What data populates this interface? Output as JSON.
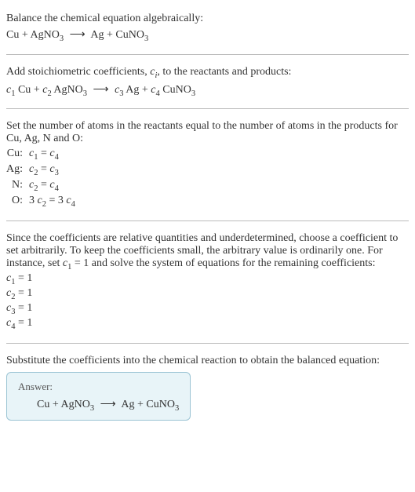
{
  "step1": {
    "title": "Balance the chemical equation algebraically:",
    "eq_lhs1": "Cu",
    "eq_plus": " + ",
    "eq_lhs2": "AgNO",
    "eq_lhs2_sub": "3",
    "eq_arrow": "⟶",
    "eq_rhs1": "Ag",
    "eq_rhs2": "CuNO",
    "eq_rhs2_sub": "3"
  },
  "step2": {
    "title_a": "Add stoichiometric coefficients, ",
    "title_ci": "c",
    "title_ci_sub": "i",
    "title_b": ", to the reactants and products:",
    "c1": "c",
    "c1s": "1",
    "t1": " Cu",
    "c2": "c",
    "c2s": "2",
    "t2": " AgNO",
    "t2s": "3",
    "c3": "c",
    "c3s": "3",
    "t3": " Ag",
    "c4": "c",
    "c4s": "4",
    "t4": " CuNO",
    "t4s": "3",
    "plus": " + ",
    "arrow": "⟶"
  },
  "step3": {
    "title": "Set the number of atoms in the reactants equal to the number of atoms in the products for Cu, Ag, N and O:",
    "rows": [
      {
        "el": "Cu:",
        "lhs_c": "c",
        "lhs_s": "1",
        "mid": " = ",
        "rhs_c": "c",
        "rhs_s": "4",
        "lhs_n": "",
        "rhs_n": ""
      },
      {
        "el": "Ag:",
        "lhs_c": "c",
        "lhs_s": "2",
        "mid": " = ",
        "rhs_c": "c",
        "rhs_s": "3",
        "lhs_n": "",
        "rhs_n": ""
      },
      {
        "el": "N:",
        "lhs_c": "c",
        "lhs_s": "2",
        "mid": " = ",
        "rhs_c": "c",
        "rhs_s": "4",
        "lhs_n": "",
        "rhs_n": ""
      },
      {
        "el": "O:",
        "lhs_c": "c",
        "lhs_s": "2",
        "mid": " = ",
        "rhs_c": "c",
        "rhs_s": "4",
        "lhs_n": "3 ",
        "rhs_n": "3 "
      }
    ]
  },
  "step4": {
    "title_a": "Since the coefficients are relative quantities and underdetermined, choose a coefficient to set arbitrarily. To keep the coefficients small, the arbitrary value is ordinarily one. For instance, set ",
    "title_c": "c",
    "title_cs": "1",
    "title_b": " = 1 and solve the system of equations for the remaining coefficients:",
    "lines": [
      {
        "c": "c",
        "s": "1",
        "v": " = 1"
      },
      {
        "c": "c",
        "s": "2",
        "v": " = 1"
      },
      {
        "c": "c",
        "s": "3",
        "v": " = 1"
      },
      {
        "c": "c",
        "s": "4",
        "v": " = 1"
      }
    ]
  },
  "step5": {
    "title": "Substitute the coefficients into the chemical reaction to obtain the balanced equation:",
    "answer_label": "Answer:",
    "eq_lhs1": "Cu",
    "eq_plus": " + ",
    "eq_lhs2": "AgNO",
    "eq_lhs2_sub": "3",
    "eq_arrow": "⟶",
    "eq_rhs1": "Ag",
    "eq_rhs2": "CuNO",
    "eq_rhs2_sub": "3"
  }
}
